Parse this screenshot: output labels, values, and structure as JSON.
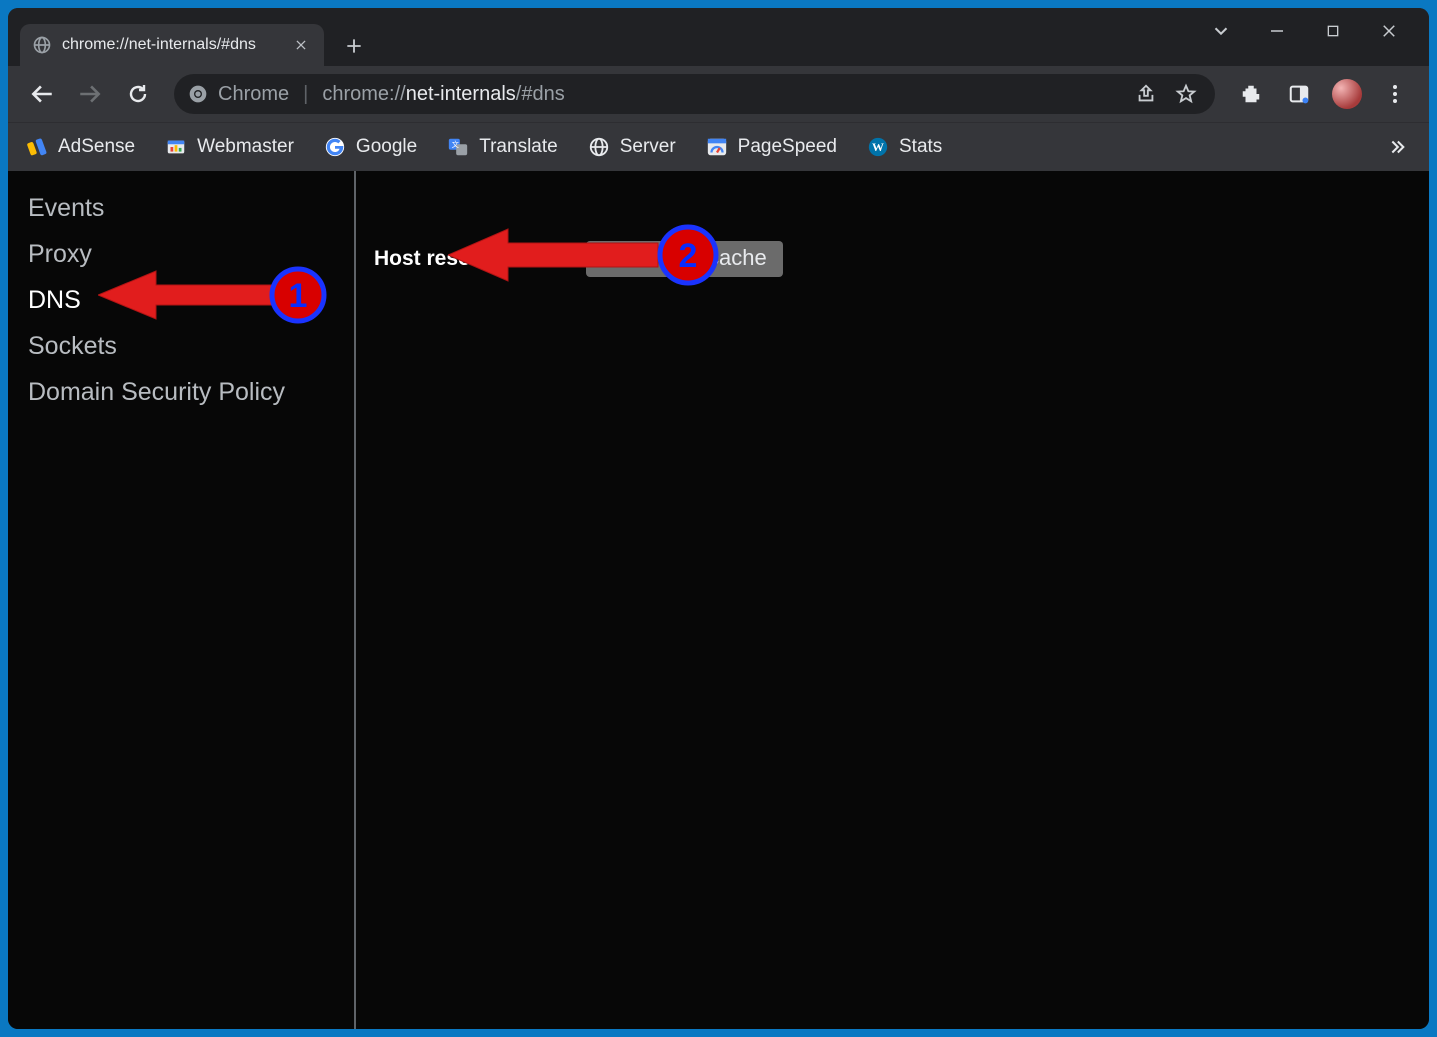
{
  "window": {
    "tab_title": "chrome://net-internals/#dns"
  },
  "omnibox": {
    "chip_label": "Chrome",
    "url_part_scheme": "chrome://",
    "url_part_host": "net-internals",
    "url_part_path": "/#dns"
  },
  "bookmarks": {
    "items": [
      {
        "label": "AdSense"
      },
      {
        "label": "Webmaster"
      },
      {
        "label": "Google"
      },
      {
        "label": "Translate"
      },
      {
        "label": "Server"
      },
      {
        "label": "PageSpeed"
      },
      {
        "label": "Stats"
      }
    ]
  },
  "sidebar": {
    "items": [
      {
        "label": "Events"
      },
      {
        "label": "Proxy"
      },
      {
        "label": "DNS"
      },
      {
        "label": "Sockets"
      },
      {
        "label": "Domain Security Policy"
      }
    ],
    "active": "DNS"
  },
  "main": {
    "section_label": "Host resolver cache",
    "clear_button": "Clear host cache"
  },
  "annotations": {
    "n1": "1",
    "n2": "2"
  }
}
